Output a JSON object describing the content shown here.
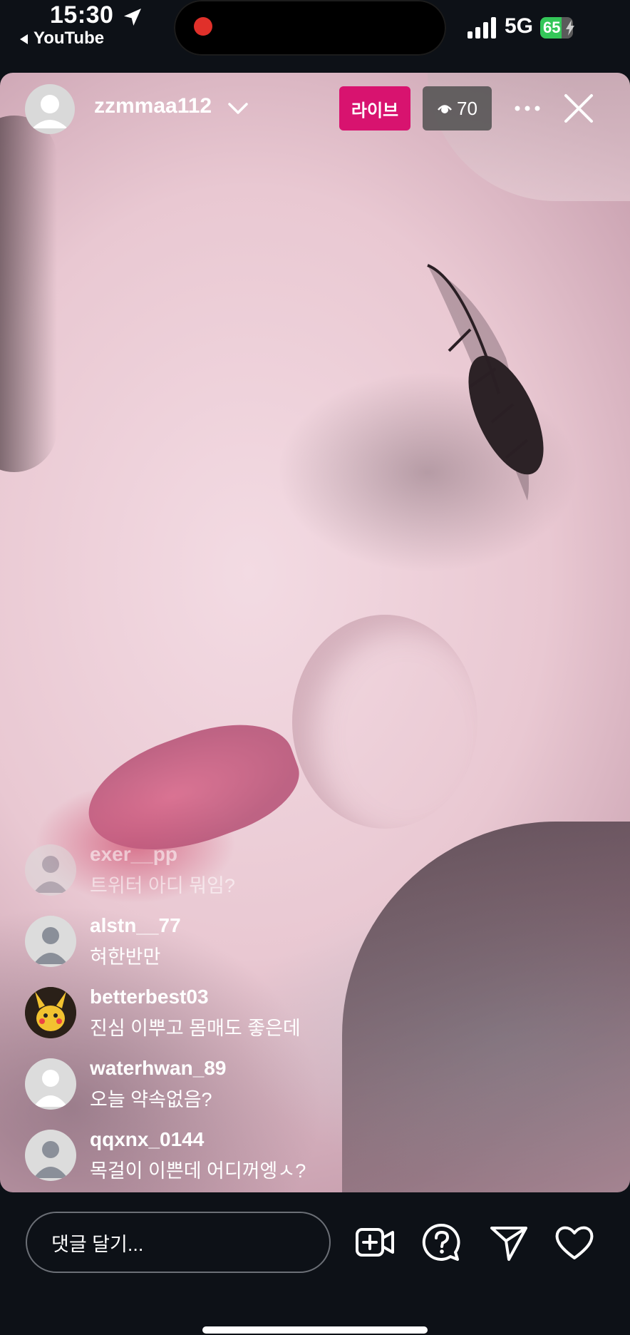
{
  "status_bar": {
    "time": "15:30",
    "back_app": "YouTube",
    "network": "5G",
    "battery_percent": "65",
    "icons": [
      "location-arrow-icon",
      "signal-icon",
      "battery-charging-icon"
    ]
  },
  "live": {
    "host_username": "zzmmaa112",
    "live_label": "라이브",
    "viewer_count": "70",
    "icons": [
      "avatar-placeholder-icon",
      "chevron-down-icon",
      "eye-icon",
      "more-dots-icon",
      "close-icon"
    ]
  },
  "comments": [
    {
      "user": "exer__pp",
      "text": "트위터 아디 뭐임?",
      "avatar": "default-avatar"
    },
    {
      "user": "alstn__77",
      "text": "혀한반만",
      "avatar": "default-avatar"
    },
    {
      "user": "betterbest03",
      "text": "진심 이뿌고 몸매도 좋은데",
      "avatar": "pikachu-avatar"
    },
    {
      "user": "waterhwan_89",
      "text": "오늘 약속없음?",
      "avatar": "default-avatar"
    },
    {
      "user": "qqxnx_0144",
      "text": "목걸이 이쁜데 어디꺼엥ㅅ?",
      "avatar": "default-avatar"
    }
  ],
  "bottom_bar": {
    "comment_placeholder": "댓글 달기...",
    "icons": [
      "add-video-icon",
      "question-icon",
      "send-icon",
      "heart-icon"
    ]
  },
  "colors": {
    "live_badge": "#d8136f",
    "background": "#0d1117",
    "battery_fill": "#34c759",
    "record_dot": "#e0302a"
  }
}
